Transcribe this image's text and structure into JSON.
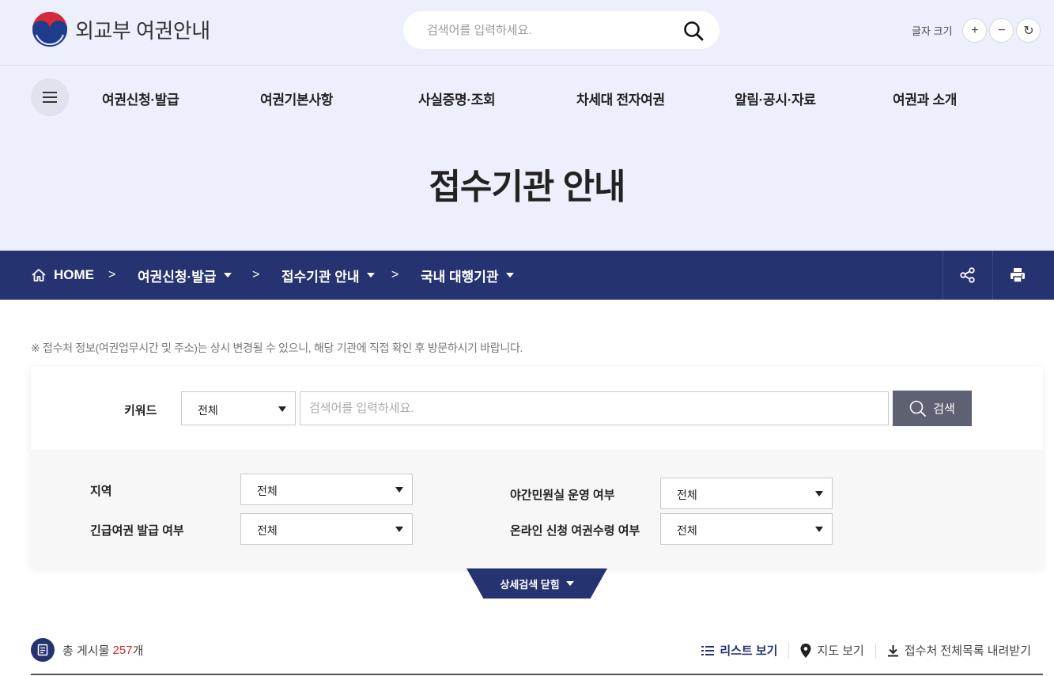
{
  "header": {
    "logo_text": "외교부 여권안내",
    "search_placeholder": "검색어를 입력하세요.",
    "fontsize_label": "글자 크기",
    "fontsize_buttons": [
      "+",
      "−",
      "↻"
    ]
  },
  "gnb": {
    "items": [
      "여권신청·발급",
      "여권기본사항",
      "사실증명·조회",
      "차세대 전자여권",
      "알림·공시·자료",
      "여권과 소개"
    ]
  },
  "page_title": "접수기관 안내",
  "breadcrumb": {
    "home": "HOME",
    "level1": "여권신청·발급",
    "level2": "접수기관 안내",
    "level3": "국내 대행기관"
  },
  "notice": "※ 접수처 정보(여권업무시간 및 주소)는 상시 변경될 수 있으니, 해당 기관에 직접 확인 후 방문하시기 바랍니다.",
  "search": {
    "keyword_label": "키워드",
    "keyword_select": "전체",
    "keyword_placeholder": "검색어를 입력하세요.",
    "search_button": "검색"
  },
  "detail": {
    "region_label": "지역",
    "region_value": "전체",
    "urgent_label": "긴급여권 발급 여부",
    "urgent_value": "전체",
    "night_label": "야간민원실 운영 여부",
    "night_value": "전체",
    "online_label": "온라인 신청 여권수령 여부",
    "online_value": "전체",
    "toggle_label": "상세검색 닫힘"
  },
  "results": {
    "total_prefix": "총 게시물 ",
    "total_count": "257",
    "total_suffix": "개",
    "list_view": "리스트 보기",
    "map_view": "지도 보기",
    "download": "접수처 전체목록 내려받기"
  },
  "colors": {
    "brand_navy": "#253371",
    "header_bg": "#eeeffd",
    "count_red": "#d0312d",
    "search_button": "#5d6172"
  }
}
